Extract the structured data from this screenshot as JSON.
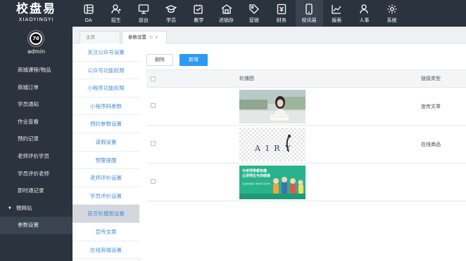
{
  "brand": {
    "name": "校盘易",
    "sub": "XIAOYINGYI"
  },
  "topnav": [
    {
      "label": "OA",
      "icon": "oa-icon",
      "active": false
    },
    {
      "label": "招生",
      "icon": "enrollment-icon",
      "active": false
    },
    {
      "label": "前台",
      "icon": "front-desk-icon",
      "active": false
    },
    {
      "label": "学员",
      "icon": "student-icon",
      "active": false
    },
    {
      "label": "教学",
      "icon": "teaching-icon",
      "active": false
    },
    {
      "label": "进销存",
      "icon": "inventory-icon",
      "active": false
    },
    {
      "label": "营销",
      "icon": "marketing-icon",
      "active": false
    },
    {
      "label": "财务",
      "icon": "finance-icon",
      "active": false
    },
    {
      "label": "校讯易",
      "icon": "mobile-icon",
      "active": true
    },
    {
      "label": "报表",
      "icon": "report-icon",
      "active": false
    },
    {
      "label": "人事",
      "icon": "hr-icon",
      "active": false
    },
    {
      "label": "系统",
      "icon": "settings-icon",
      "active": false
    }
  ],
  "user": {
    "avatar_text": "76",
    "name": "admin"
  },
  "sidebar": [
    {
      "label": "商城课程/物品"
    },
    {
      "label": "商城订单"
    },
    {
      "label": "学员通知"
    },
    {
      "label": "作业查看"
    },
    {
      "label": "预约记录"
    },
    {
      "label": "老师评价学员"
    },
    {
      "label": "学员评价老师"
    },
    {
      "label": "即时通记录"
    },
    {
      "label": "微网站"
    },
    {
      "label": "参数设置"
    }
  ],
  "tabs": [
    {
      "label": "主页"
    },
    {
      "label": "参数设置",
      "close": "⊙ ×"
    }
  ],
  "submenu": [
    {
      "label": "关注公众号设置"
    },
    {
      "label": "公众号功能权限"
    },
    {
      "label": "小程序功能权限"
    },
    {
      "label": "小程序码参数"
    },
    {
      "label": "预约参数设置"
    },
    {
      "label": "请假设置"
    },
    {
      "label": "预警提醒"
    },
    {
      "label": "老师评价设置"
    },
    {
      "label": "学员评价设置"
    },
    {
      "label": "首页轮播图设置"
    },
    {
      "label": "宣传文章"
    },
    {
      "label": "在线商城设置"
    }
  ],
  "toolbar": {
    "delete_label": "删除",
    "add_label": "新增"
  },
  "table": {
    "columns": {
      "image": "轮播图",
      "link_type": "链接类型"
    },
    "rows": [
      {
        "image": "girl-reading-photo",
        "link_type": "宣传文章"
      },
      {
        "image": "airy-logo-banner",
        "link_type": "在线商品"
      },
      {
        "image": "teachers-recruiting-banner",
        "link_type": ""
      }
    ]
  },
  "banner": {
    "airy_text": "A  I R Y",
    "green_title": "与老师带都有趣\n让讲师生与你结缘",
    "green_sub": "专业教师团队 你的学习好伙伴"
  },
  "colors": {
    "topbar_bg": "#2b333e",
    "accent": "#2b9af3",
    "link": "#4a8fd1",
    "active_sub": "#d4d7de",
    "banner_green": "#28b38c"
  }
}
